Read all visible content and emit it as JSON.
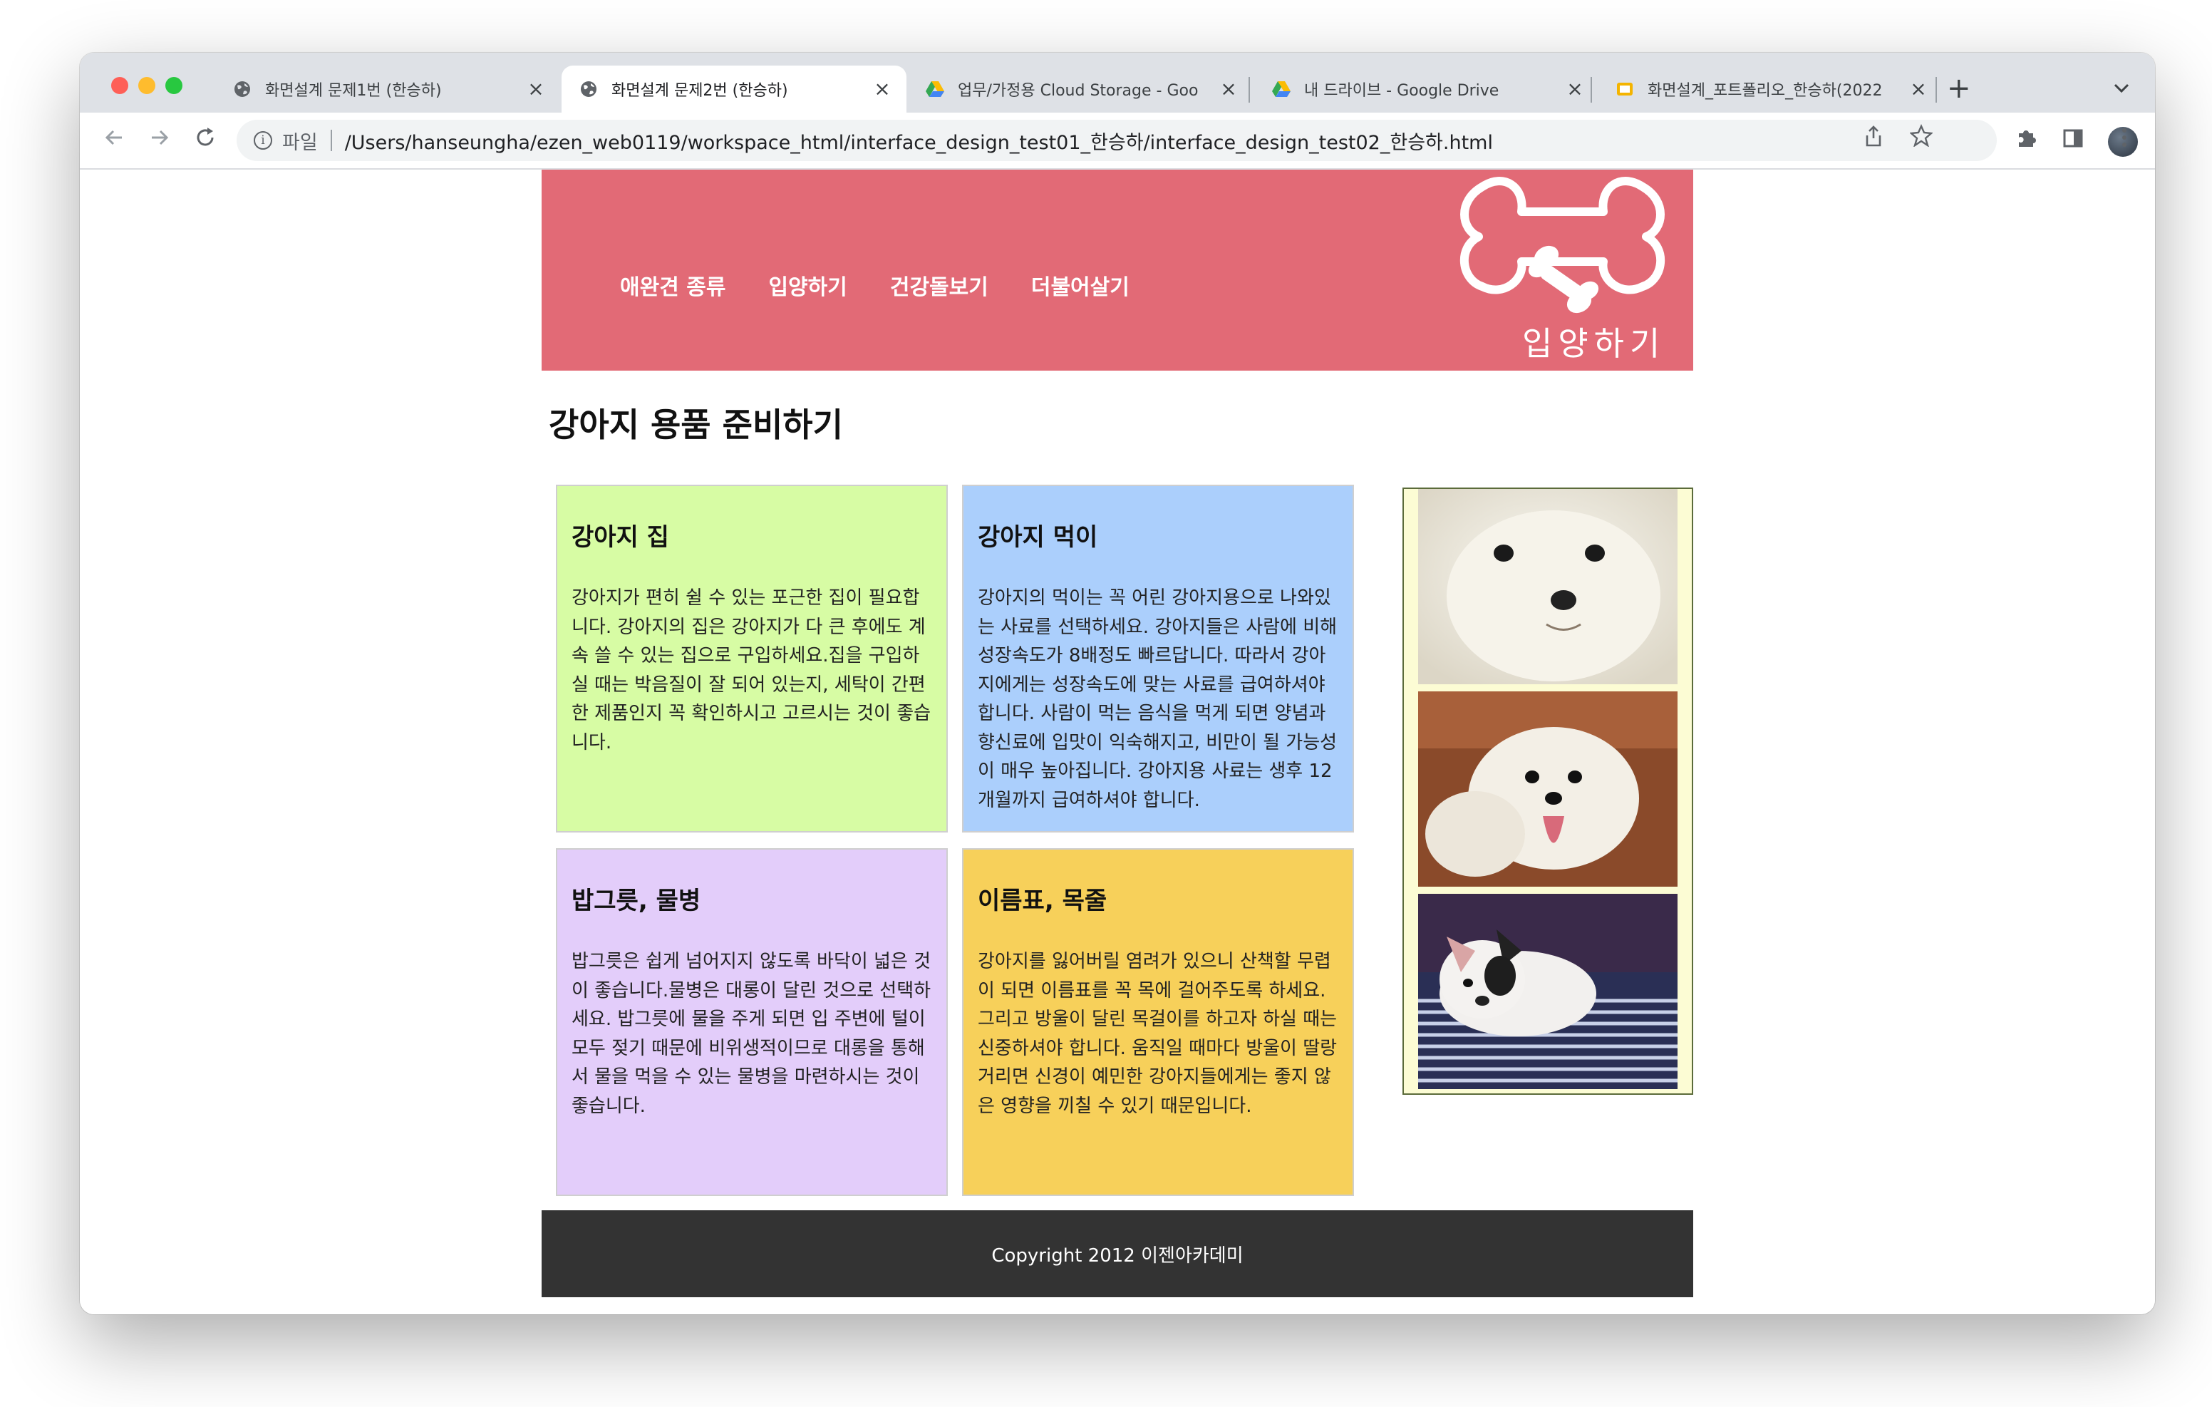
{
  "browser": {
    "tabs": [
      {
        "title": "화면설계 문제1번 (한승하)",
        "favicon": "globe-icon",
        "active": false
      },
      {
        "title": "화면설계 문제2번 (한승하)",
        "favicon": "globe-icon",
        "active": true
      },
      {
        "title": "업무/가정용 Cloud Storage - Goo",
        "favicon": "google-drive-icon",
        "active": false
      },
      {
        "title": "내 드라이브 - Google Drive",
        "favicon": "google-drive-icon",
        "active": false
      },
      {
        "title": "화면설계_포트폴리오_한승하(2022",
        "favicon": "google-slides-icon",
        "active": false
      }
    ],
    "close_glyph": "×",
    "new_tab_glyph": "+",
    "address": {
      "scheme_label": "파일",
      "url": "/Users/hanseungha/ezen_web0119/workspace_html/interface_design_test01_한승하/interface_design_test02_한승하.html"
    }
  },
  "site": {
    "nav": [
      "애완견 종류",
      "입양하기",
      "건강돌보기",
      "더불어살기"
    ],
    "logo_text": "입양하기",
    "page_title": "강아지 용품 준비하기",
    "cards": [
      {
        "title": "강아지 집",
        "body": "강아지가 편히 쉴 수 있는 포근한 집이 필요합니다. 강아지의 집은 강아지가 다 큰 후에도 계속 쓸 수 있는 집으로 구입하세요.집을 구입하실 때는 박음질이 잘 되어 있는지, 세탁이 간편한 제품인지 꼭 확인하시고 고르시는 것이 좋습니다."
      },
      {
        "title": "강아지 먹이",
        "body": "강아지의 먹이는 꼭 어린 강아지용으로 나와있는 사료를 선택하세요. 강아지들은 사람에 비해 성장속도가 8배정도 빠르답니다. 따라서 강아지에게는 성장속도에 맞는 사료를 급여하셔야 합니다. 사람이 먹는 음식을 먹게 되면 양념과 향신료에 입맛이 익숙해지고, 비만이 될 가능성이 매우 높아집니다. 강아지용 사료는 생후 12개월까지 급여하셔야 합니다."
      },
      {
        "title": "밥그릇, 물병",
        "body": "밥그릇은 쉽게 넘어지지 않도록 바닥이 넓은 것이 좋습니다.물병은 대롱이 달린 것으로 선택하세요. 밥그릇에 물을 주게 되면 입 주변에 털이 모두 젖기 때문에 비위생적이므로 대롱을 통해서 물을 먹을 수 있는 물병을 마련하시는 것이 좋습니다."
      },
      {
        "title": "이름표, 목줄",
        "body": "강아지를 잃어버릴 염려가 있으니 산책할 무렵이 되면 이름표를 꼭 목에 걸어주도록 하세요. 그리고 방울이 달린 목걸이를 하고자 하실 때는 신중하셔야 합니다. 움직일 때마다 방울이 딸랑 거리면 신경이 예민한 강아지들에게는 좋지 않은 영향을 끼칠 수 있기 때문입니다."
      }
    ],
    "photos": [
      "white-puppy-photo",
      "maltese-tongue-photo",
      "bulldog-on-grate-photo"
    ],
    "footer": "Copyright 2012 이젠아카데미"
  },
  "colors": {
    "header_bg": "#e26a76",
    "card_green": "#d7fca4",
    "card_blue": "#abcffc",
    "card_purple": "#e3cdfa",
    "card_yellow": "#f7d05a",
    "sidebar_bg": "#fcfcd4",
    "footer_bg": "#333333"
  }
}
